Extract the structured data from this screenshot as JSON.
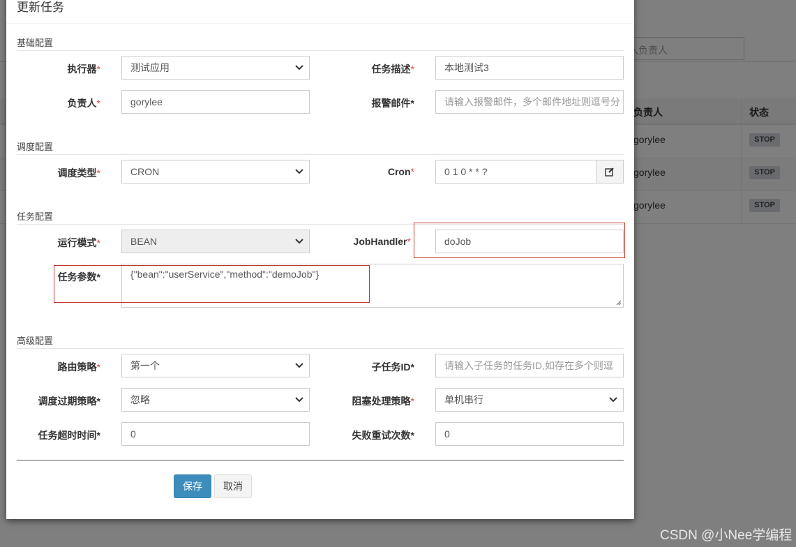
{
  "background": {
    "search_placeholder": "入负责人",
    "table_headers": {
      "owner": "负责人",
      "status": "状态"
    },
    "rows": [
      {
        "owner": "gorylee",
        "status": "STOP"
      },
      {
        "owner": "gorylee",
        "status": "STOP"
      },
      {
        "owner": "gorylee",
        "status": "STOP"
      }
    ]
  },
  "modal": {
    "title": "更新任务",
    "sections": {
      "basic": "基础配置",
      "schedule": "调度配置",
      "task": "任务配置",
      "advanced": "高级配置"
    },
    "fields": {
      "executor": {
        "label": "执行器",
        "value": "测试应用"
      },
      "job_desc": {
        "label": "任务描述",
        "value": "本地测试3"
      },
      "author": {
        "label": "负责人",
        "value": "gorylee"
      },
      "alarm_email": {
        "label": "报警邮件",
        "placeholder": "请输入报警邮件，多个邮件地址则逗号分"
      },
      "schedule_type": {
        "label": "调度类型",
        "value": "CRON"
      },
      "cron": {
        "label": "Cron",
        "value": "0 1 0 * * ?"
      },
      "run_mode": {
        "label": "运行模式",
        "value": "BEAN"
      },
      "job_handler": {
        "label": "JobHandler",
        "value": "doJob"
      },
      "job_param": {
        "label": "任务参数",
        "value": "{\"bean\":\"userService\",\"method\":\"demoJob\"}"
      },
      "route_strategy": {
        "label": "路由策略",
        "value": "第一个"
      },
      "child_job_id": {
        "label": "子任务ID",
        "placeholder": "请输入子任务的任务ID,如存在多个则逗"
      },
      "misfire_strategy": {
        "label": "调度过期策略",
        "value": "忽略"
      },
      "block_strategy": {
        "label": "阻塞处理策略",
        "value": "单机串行"
      },
      "timeout": {
        "label": "任务超时时间",
        "value": "0"
      },
      "fail_retry": {
        "label": "失败重试次数",
        "value": "0"
      }
    },
    "required_mark": "*",
    "buttons": {
      "save": "保存",
      "cancel": "取消"
    }
  },
  "watermark": "CSDN @小Nee学编程",
  "colors": {
    "primary": "#3c8dbc",
    "required": "#e34444",
    "highlight_box": "#c0392b",
    "backdrop": "#7f7f7f"
  }
}
